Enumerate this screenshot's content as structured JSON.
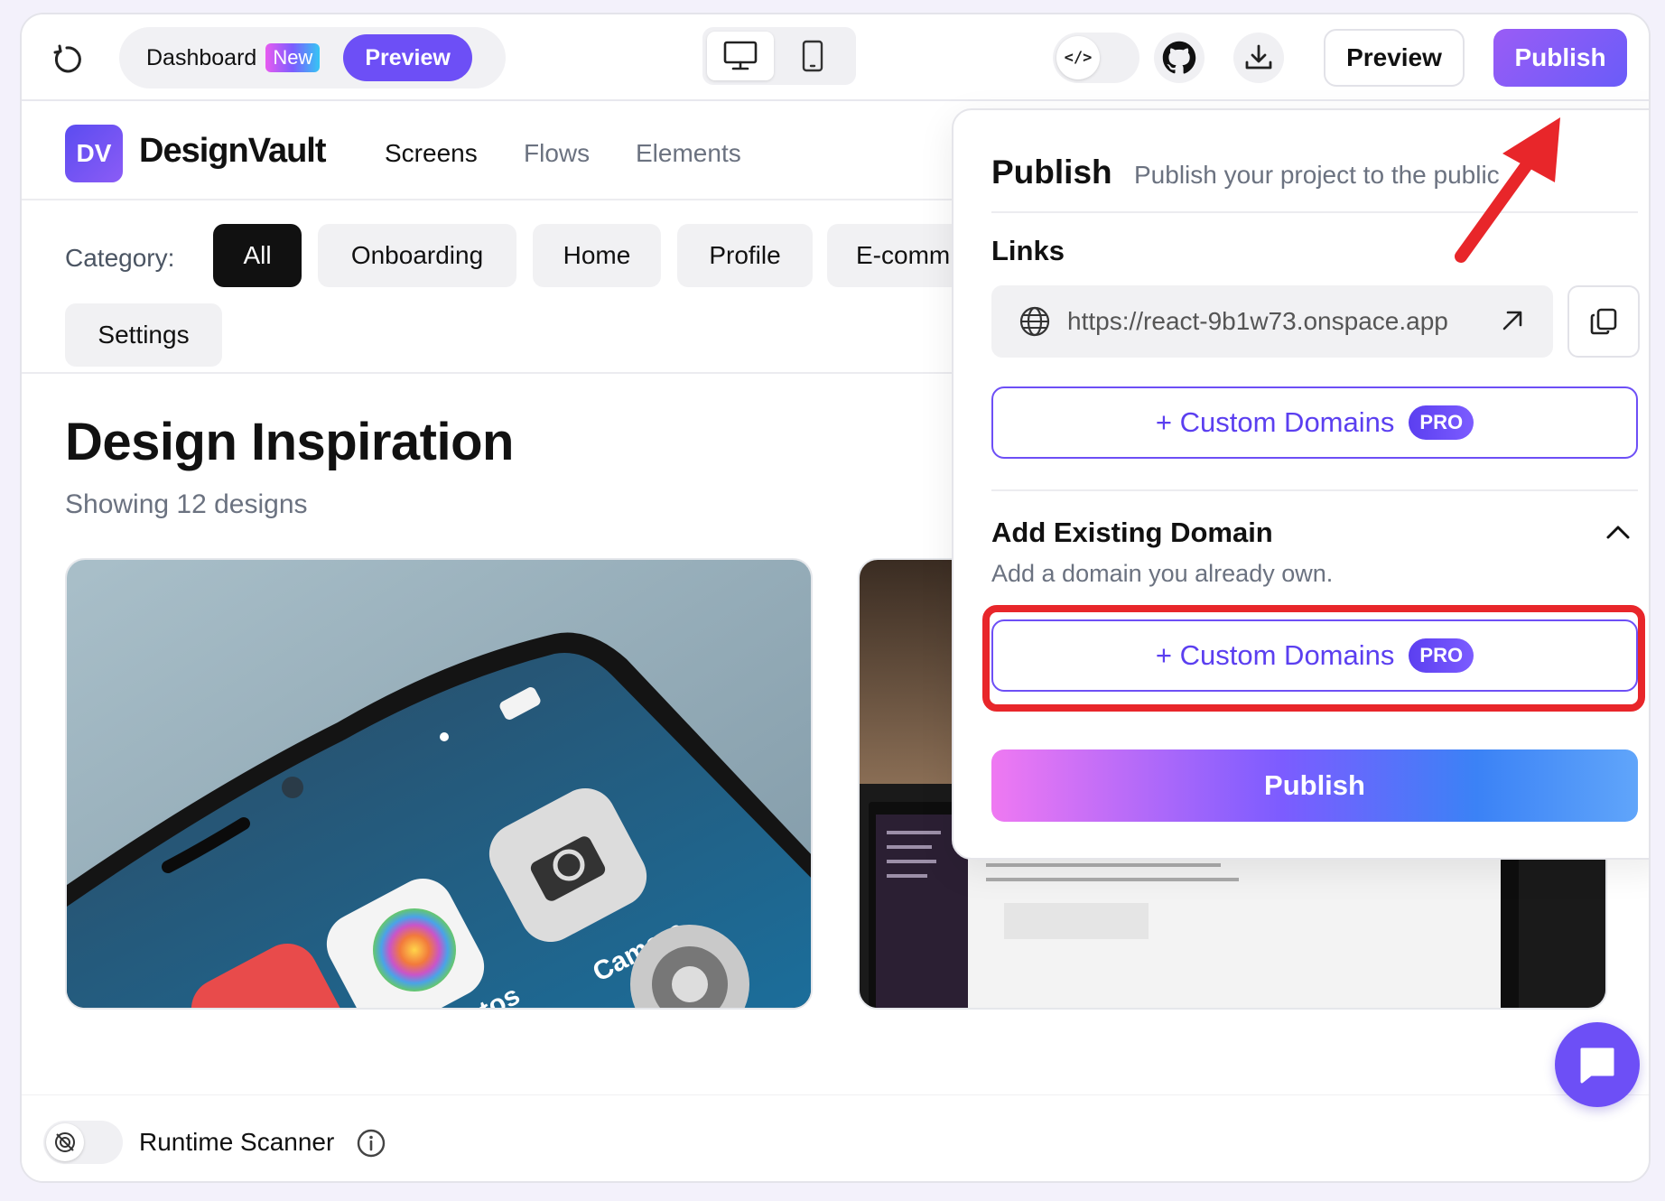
{
  "toolbar": {
    "dashboard_label": "Dashboard",
    "new_badge": "New",
    "preview_pill": "Preview",
    "preview_button": "Preview",
    "publish_button": "Publish"
  },
  "site": {
    "logo_mark": "DV",
    "logo_text": "DesignVault",
    "nav": [
      "Screens",
      "Flows",
      "Elements"
    ]
  },
  "categories": {
    "label": "Category:",
    "items": [
      "All",
      "Onboarding",
      "Home",
      "Profile",
      "E-comm",
      "Settings"
    ],
    "selected": "All"
  },
  "content": {
    "title": "Design Inspiration",
    "subtitle": "Showing 12 designs"
  },
  "cards": {
    "card1_app_label_1": "Camera",
    "card1_app_label_2": "hotos"
  },
  "bottom": {
    "scanner_label": "Runtime Scanner"
  },
  "publish_panel": {
    "title": "Publish",
    "description": "Publish your project to the public",
    "links_label": "Links",
    "url": "https://react-9b1w73.onspace.app",
    "custom_domains_label": "+ Custom Domains",
    "pro_badge": "PRO",
    "existing_title": "Add Existing Domain",
    "existing_desc": "Add a domain you already own.",
    "publish_button": "Publish"
  },
  "colors": {
    "accent": "#6d4ff6",
    "annotation_red": "#e8262a"
  }
}
